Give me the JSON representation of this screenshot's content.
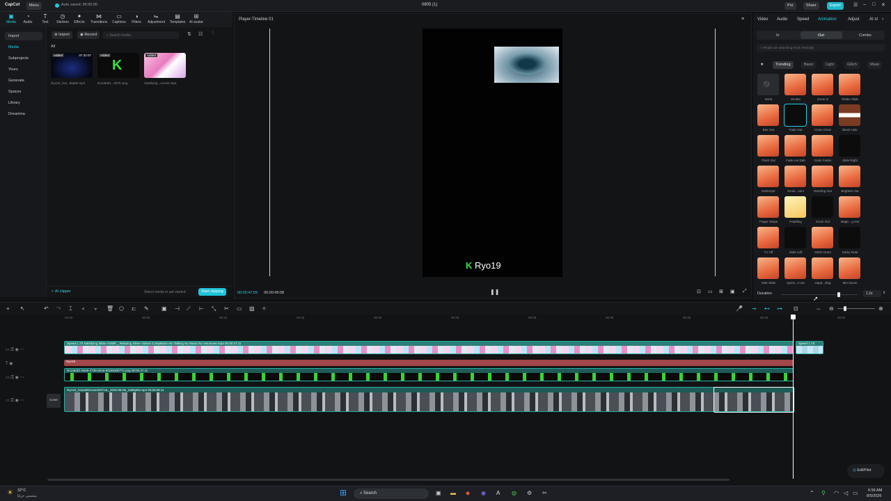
{
  "titlebar": {
    "app_logo": "CapCut",
    "menu": "Menu",
    "autosave": "Auto saved: 06:56:00",
    "project_title": "0805 (1)",
    "pro": "Pro",
    "share": "Share",
    "export": "Export"
  },
  "toolbar": {
    "tabs": [
      "Media",
      "Audio",
      "Text",
      "Stickers",
      "Effects",
      "Transitions",
      "Captions",
      "Filters",
      "Adjustment",
      "Templates",
      "AI avatar"
    ]
  },
  "sidebar": {
    "items": [
      "Import",
      "Media",
      "Subprojects",
      "Yours",
      "Generate",
      "Spaces",
      "Library",
      "Dreamina"
    ]
  },
  "media": {
    "import_btn": "Import",
    "record_btn": "Record",
    "search_placeholder": "Search media",
    "filter_all": "All",
    "items": [
      {
        "badge": "Added",
        "duration": "07:32:07",
        "name": "Ryo19_Gra...80p60.mp4"
      },
      {
        "badge": "Added",
        "duration": "",
        "name": "9c1a8d21...057fc.png"
      },
      {
        "badge": "Added",
        "duration": "",
        "name": "Satisfying...coover.mp4"
      }
    ],
    "ai_clipper": "AI clipper",
    "select_media": "Select media to get started",
    "start_clipping": "Start clipping"
  },
  "player": {
    "title": "Player-Timeline 01",
    "current_time": "00:00:47:09",
    "total_time": "00:00:49:08",
    "watermark": "Ryo19"
  },
  "right_panel": {
    "tabs": [
      "Video",
      "Audio",
      "Speed",
      "Animation",
      "Adjust",
      "AI st"
    ],
    "active_tab": "Animation",
    "subtabs": [
      "In",
      "Out",
      "Combo"
    ],
    "search_text": "People are searching Rock Vertically",
    "filters": [
      "Trending",
      "Basic",
      "Light",
      "Glitch",
      "Mask"
    ],
    "effects": [
      "None",
      "Smoke",
      "Zoom in",
      "Shake Slide",
      "Blur Out",
      "Fade Out",
      "Cross Close",
      "Black Hole",
      "Flash Out",
      "Fade-out Dab",
      "Grain Fades",
      "Slide Right",
      "Destroyer",
      "Smok...ours",
      "Dazzling Out",
      "Brighten Out",
      "Finger Swipe",
      "Paddling",
      "Zoom Out",
      "Magic...g Out",
      "TV Off",
      "Slide Left",
      "Glitch Outro",
      "Sticky Note",
      "Side Slide",
      "Quick...n-out",
      "Happ...ding",
      "Mini Zoom"
    ],
    "duration_label": "Duration",
    "duration_value": "1.2s"
  },
  "timeline": {
    "ruler": [
      "00:00",
      "00:05",
      "00:10",
      "00:15",
      "00:20",
      "00:25",
      "00:30",
      "00:35",
      "00:40",
      "00:45",
      "00:50"
    ],
    "track1_label": "Speed 1.7X  Satisfying Slime ASMR _ Relaxing Slime Videos Compilation No Talking No Music No Voiceover.mp4  00:00:47:11",
    "track1_end_label": "Speed 1.7X",
    "track2_label": "Ryo19",
    "track3_label": "9c1a8d21-6649-4736-9216-8dc6530077c.png  00:00:47:11",
    "track4_label": "Ryo19_Grand20Auto20STAtL_2026-08-05_1080p60.mp4  00:00:09:11",
    "cover": "Cover"
  },
  "editpilot": "EditPilot",
  "taskbar": {
    "weather_temp": "32°C",
    "weather_text": "مشمس جزئيًا",
    "search": "Search",
    "time": "6:56 AM",
    "date": "8/5/2026"
  }
}
